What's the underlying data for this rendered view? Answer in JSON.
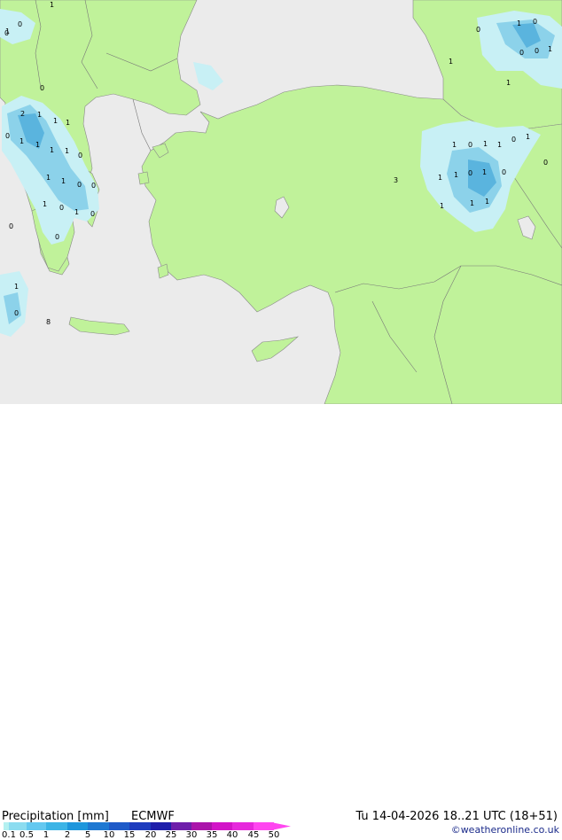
{
  "title": "Precipitation [mm]",
  "model": "ECMWF",
  "valid_time": "Tu 14-04-2026 18..21 UTC (18+51)",
  "credit": "©weatheronline.co.uk",
  "legend": {
    "labels": [
      "0.1",
      "0.5",
      "1",
      "2",
      "5",
      "10",
      "15",
      "20",
      "25",
      "30",
      "35",
      "40",
      "45",
      "50"
    ],
    "colors": [
      "#b4f0f0",
      "#8cdcf0",
      "#64c8f0",
      "#3cb4e6",
      "#1e96dc",
      "#1e78d2",
      "#1e5ac8",
      "#1e3cbe",
      "#1e1eaa",
      "#6e1eaa",
      "#aa14aa",
      "#d214c8",
      "#e628dc",
      "#ff46f0"
    ]
  },
  "colors": {
    "land": "#c0f29a",
    "sea": "#ebebeb",
    "precip_light": "#c8f0f5",
    "precip_moderate": "#8cd2ea",
    "precip_heavy": "#5ab4de"
  },
  "map_labels": [
    "1",
    "0",
    "0",
    "1",
    "0",
    "2",
    "1",
    "1",
    "1",
    "0",
    "1",
    "1",
    "1",
    "0",
    "1",
    "1",
    "1",
    "0",
    "0",
    "1",
    "0",
    "1",
    "0",
    "0",
    "0",
    "1",
    "0",
    "8",
    "1",
    "0",
    "0",
    "1",
    "0",
    "0",
    "1",
    "1",
    "1",
    "0",
    "1",
    "1",
    "0",
    "1",
    "3",
    "1",
    "1",
    "0",
    "1",
    "0",
    "0",
    "1",
    "1",
    "1"
  ]
}
